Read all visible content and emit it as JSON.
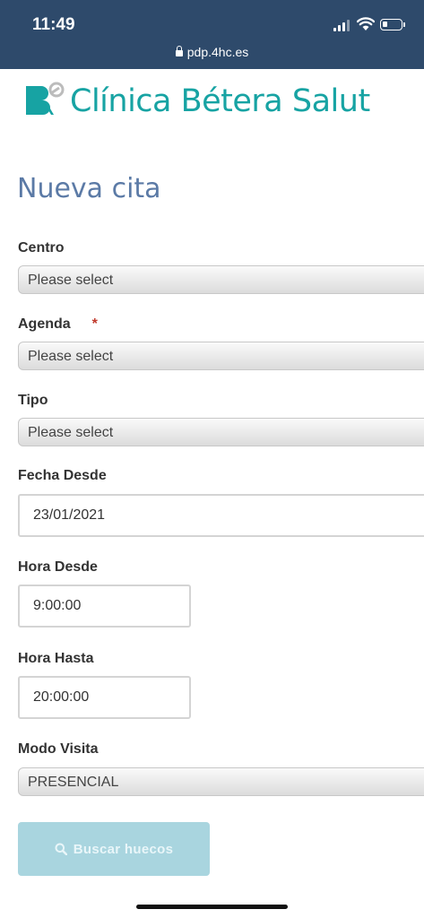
{
  "status_bar": {
    "time": "11:49",
    "url": "pdp.4hc.es"
  },
  "logo": {
    "text": "Clínica Bétera Salut",
    "color": "#17a3a3"
  },
  "page": {
    "title": "Nueva cita"
  },
  "form": {
    "centro": {
      "label": "Centro",
      "value": "Please select"
    },
    "agenda": {
      "label": "Agenda",
      "required_mark": "*",
      "value": "Please select"
    },
    "tipo": {
      "label": "Tipo",
      "value": "Please select"
    },
    "fecha_desde": {
      "label": "Fecha Desde",
      "value": "23/01/2021"
    },
    "hora_desde": {
      "label": "Hora Desde",
      "value": "9:00:00"
    },
    "hora_hasta": {
      "label": "Hora Hasta",
      "value": "20:00:00"
    },
    "modo_visita": {
      "label": "Modo Visita",
      "value": "PRESENCIAL"
    }
  },
  "actions": {
    "search_label": "Buscar huecos",
    "search_icon": "search-icon",
    "button_color": "#a9d5df"
  },
  "colors": {
    "header": "#2e4a6b",
    "title": "#5b7aa6",
    "required": "#c0392b"
  }
}
